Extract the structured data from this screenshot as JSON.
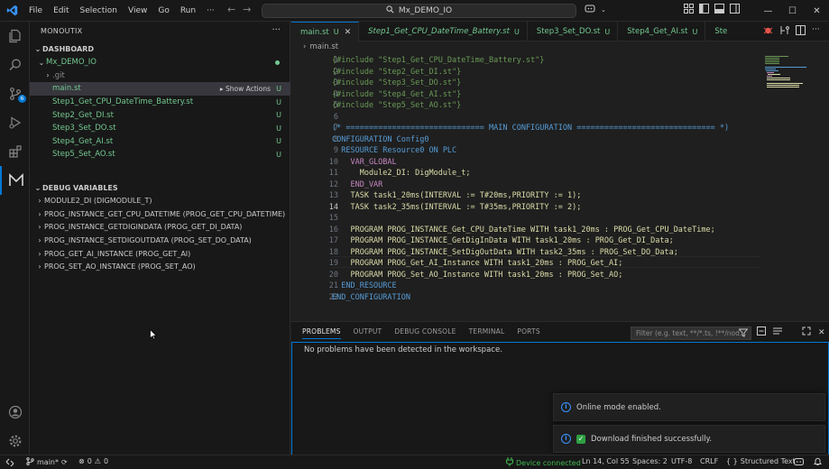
{
  "titlebar": {
    "menus": [
      "File",
      "Edit",
      "Selection",
      "View",
      "Go",
      "Run",
      "···"
    ],
    "command_center": "Mx_DEMO_IO"
  },
  "activity": {
    "source_control_badge": "6"
  },
  "sidebar": {
    "title": "MONOUTIX",
    "more": "···",
    "dashboard_header": "DASHBOARD",
    "root_folder": "Mx_DEMO_IO",
    "items": [
      {
        "label": ".git",
        "status": "",
        "type": "folder"
      },
      {
        "label": "main.st",
        "status": "U",
        "type": "file"
      },
      {
        "label": "Step1_Get_CPU_DateTime_Battery.st",
        "status": "U",
        "type": "file"
      },
      {
        "label": "Step2_Get_DI.st",
        "status": "U",
        "type": "file"
      },
      {
        "label": "Step3_Set_DO.st",
        "status": "U",
        "type": "file"
      },
      {
        "label": "Step4_Get_AI.st",
        "status": "U",
        "type": "file"
      },
      {
        "label": "Step5_Set_AO.st",
        "status": "U",
        "type": "file"
      }
    ],
    "show_actions": "Show Actions",
    "debug_header": "DEBUG VARIABLES",
    "debug_vars": [
      "MODULE2_DI (DIGMODULE_T)",
      "PROG_INSTANCE_GET_CPU_DATETIME (PROG_GET_CPU_DATETIME)",
      "PROG_INSTANCE_GETDIGINDATA (PROG_GET_DI_DATA)",
      "PROG_INSTANCE_SETDIGOUTDATA (PROG_SET_DO_DATA)",
      "PROG_GET_AI_INSTANCE (PROG_GET_AI)",
      "PROG_SET_AO_INSTANCE (PROG_SET_AO)"
    ]
  },
  "tabs": [
    {
      "label": "main.st",
      "mark": "U",
      "active": true
    },
    {
      "label": "Step1_Get_CPU_DateTime_Battery.st",
      "mark": "U",
      "active": false
    },
    {
      "label": "Step3_Set_DO.st",
      "mark": "U",
      "active": false
    },
    {
      "label": "Step4_Get_AI.st",
      "mark": "U",
      "active": false
    },
    {
      "label": "Ste",
      "mark": "",
      "active": false
    }
  ],
  "breadcrumb": {
    "chevron": "›",
    "file": "main.st"
  },
  "editor": {
    "current_line": 14,
    "lines": [
      "{#include \"Step1_Get_CPU_DateTime_Battery.st\"}",
      "{#include \"Step2_Get_DI.st\"}",
      "{#include \"Step3_Set_DO.st\"}",
      "{#include \"Step4_Get_AI.st\"}",
      "{#include \"Step5_Set_AO.st\"}",
      "",
      "(* ============================== MAIN CONFIGURATION ============================== *)",
      "CONFIGURATION Config0",
      "  RESOURCE Resource0 ON PLC",
      "    VAR_GLOBAL",
      "      Module2_DI: DigModule_t;",
      "    END_VAR",
      "    TASK task1_20ms(INTERVAL := T#20ms,PRIORITY := 1);",
      "    TASK task2_35ms(INTERVAL := T#35ms,PRIORITY := 2);",
      "",
      "    PROGRAM PROG_INSTANCE_Get_CPU_DateTime WITH task1_20ms : PROG_Get_CPU_DateTime;",
      "    PROGRAM PROG_INSTANCE_GetDigInData WITH task1_20ms : PROG_Get_DI_Data;",
      "    PROGRAM PROG_INSTANCE_SetDigOutData WITH task2_35ms : PROG_Set_DO_Data;",
      "    PROGRAM PROG_Get_AI_Instance WITH task1_20ms : PROG_Get_AI;",
      "    PROGRAM PROG_Set_AO_Instance WITH task1_20ms : PROG_Set_AO;",
      "  END_RESOURCE",
      "END_CONFIGURATION"
    ]
  },
  "panel": {
    "tabs": [
      "PROBLEMS",
      "OUTPUT",
      "DEBUG CONSOLE",
      "TERMINAL",
      "PORTS"
    ],
    "filter_placeholder": "Filter (e.g. text, **/*.ts, !**/nod...",
    "message": "No problems have been detected in the workspace."
  },
  "notifications": [
    {
      "text": "Online mode enabled."
    },
    {
      "text": "Download finished successfully."
    }
  ],
  "statusbar": {
    "branch": "main*",
    "errors": "0",
    "warnings": "0",
    "device": "Device connected",
    "position": "Ln 14, Col 55",
    "spaces": "Spaces: 2",
    "encoding": "UTF-8",
    "eol": "CRLF",
    "language": "Structured Text"
  },
  "colors": {
    "accent": "#0078d4",
    "untracked": "#73c991",
    "connected": "#3fb950"
  }
}
